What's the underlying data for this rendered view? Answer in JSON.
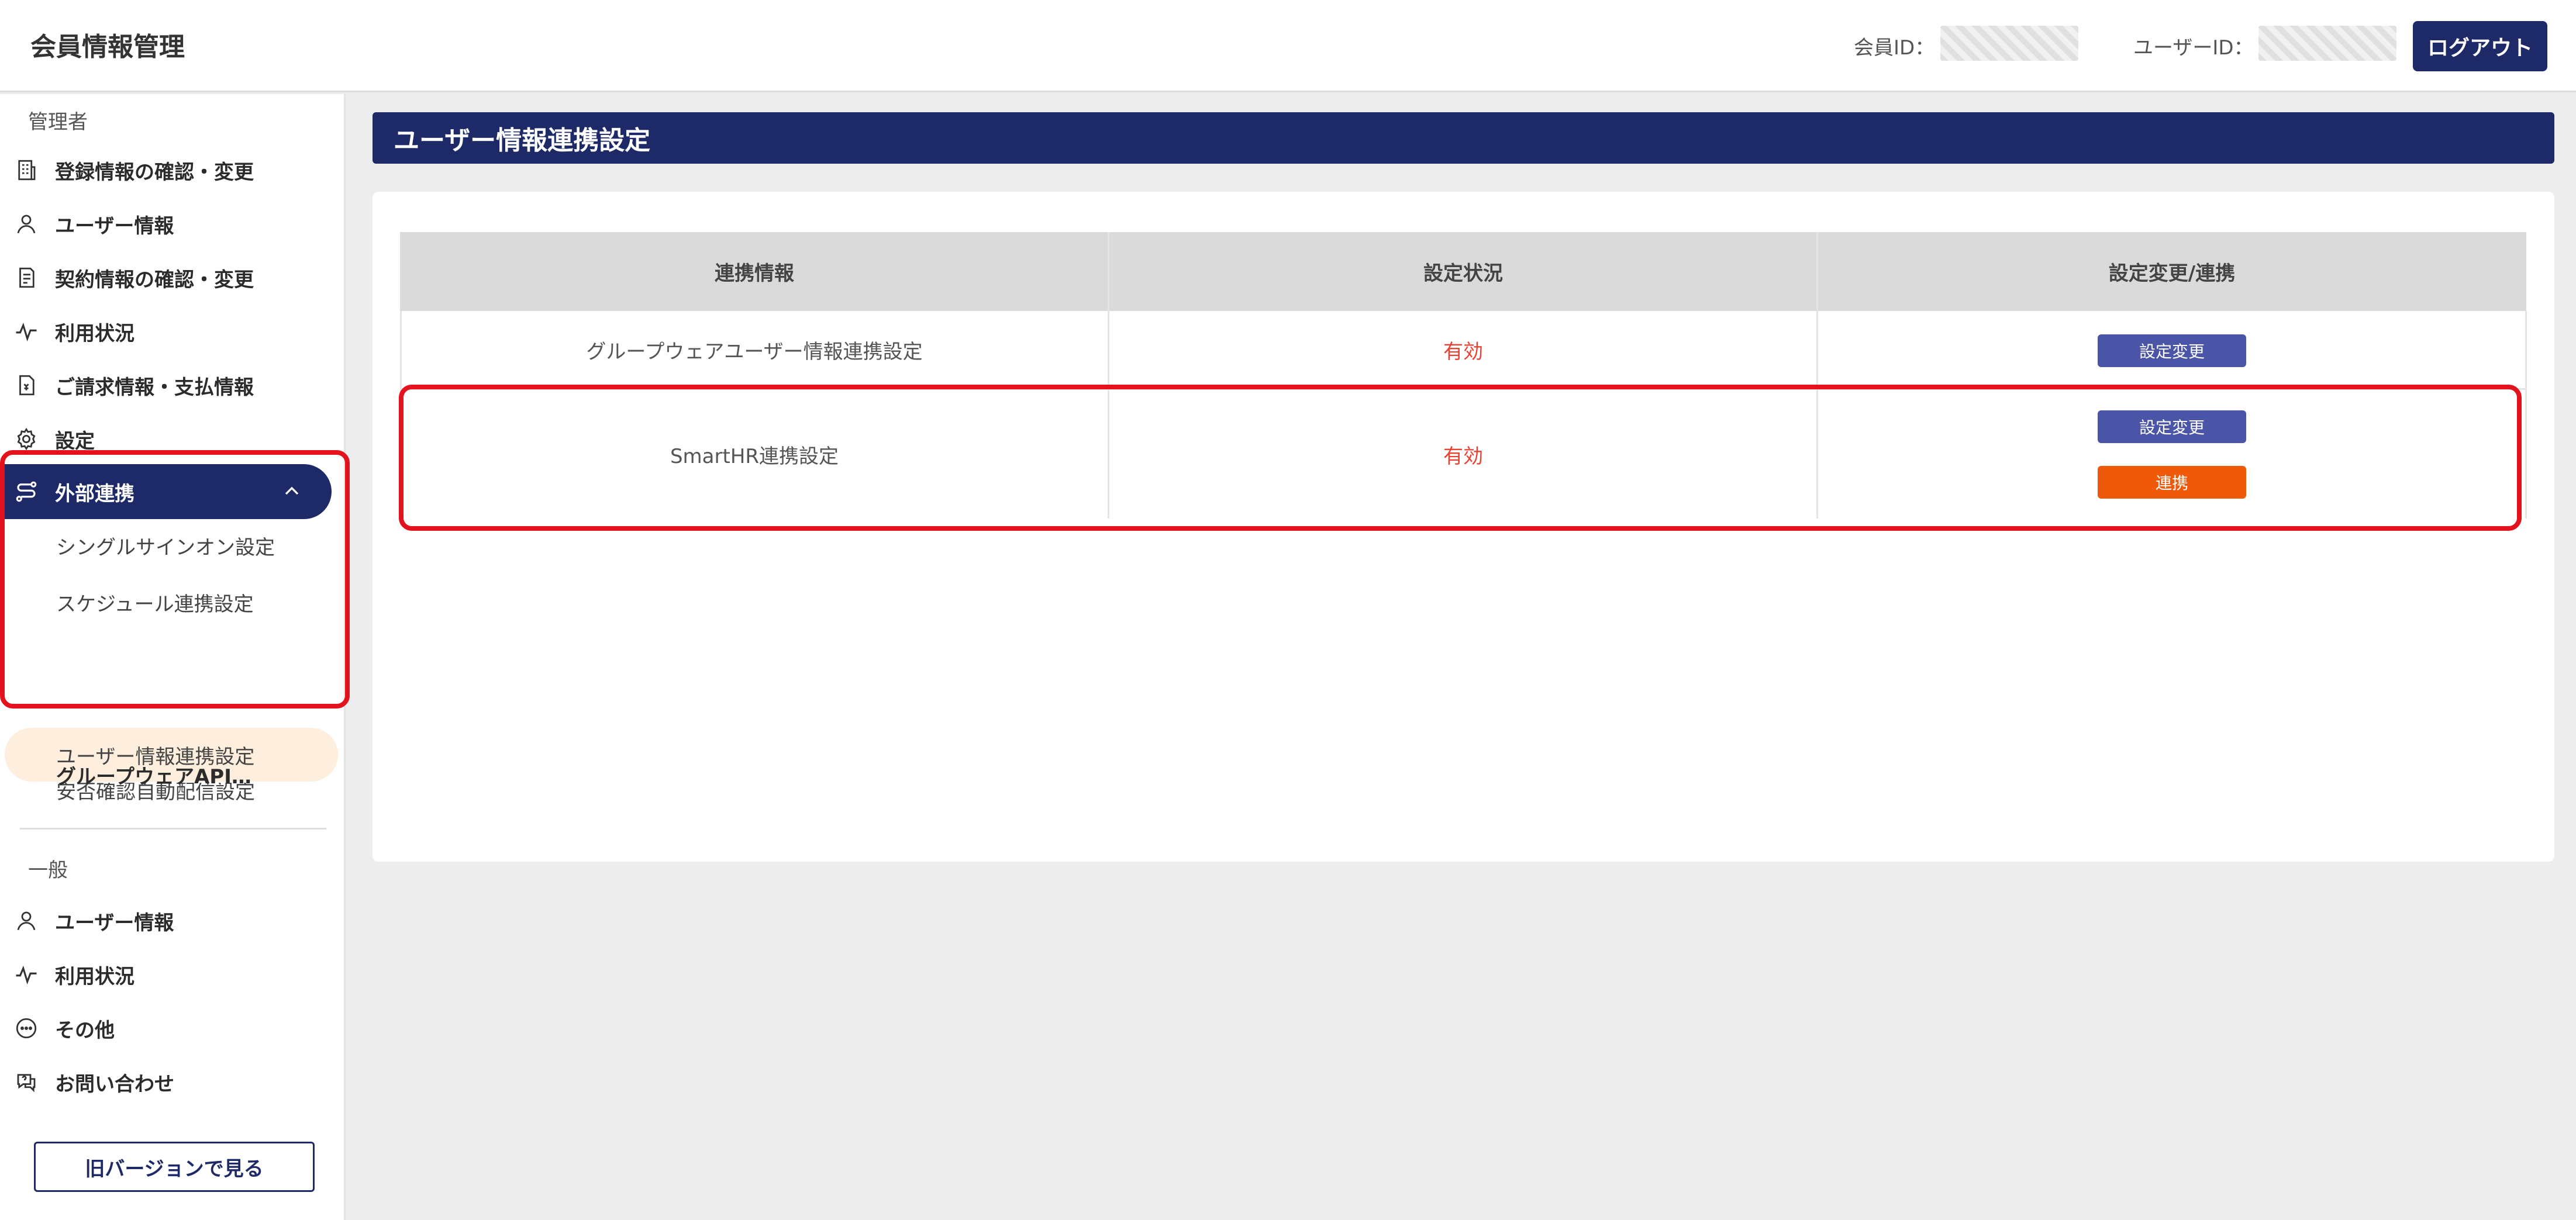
{
  "header": {
    "title": "会員情報管理",
    "member_id_label": "会員ID：",
    "user_id_label": "ユーザーID：",
    "logout_label": "ログアウト"
  },
  "sidebar": {
    "admin_section_label": "管理者",
    "admin_items": [
      {
        "label": "登録情報の確認・変更",
        "icon": "building-icon"
      },
      {
        "label": "ユーザー情報",
        "icon": "user-icon"
      },
      {
        "label": "契約情報の確認・変更",
        "icon": "document-icon"
      },
      {
        "label": "利用状況",
        "icon": "activity-icon"
      },
      {
        "label": "ご請求情報・支払情報",
        "icon": "invoice-icon"
      },
      {
        "label": "設定",
        "icon": "gear-icon"
      }
    ],
    "active_group": {
      "label": "外部連携",
      "icon": "integration-icon",
      "expanded": true
    },
    "sub_items": [
      "シングルサインオン設定",
      "スケジュール連携設定",
      "ユーザー情報連携設定",
      "安否確認自動配信設定",
      "グループウェアAPI…"
    ],
    "active_sub_index": 2,
    "general_section_label": "一般",
    "general_items": [
      {
        "label": "ユーザー情報",
        "icon": "user-icon"
      },
      {
        "label": "利用状況",
        "icon": "activity-icon"
      },
      {
        "label": "その他",
        "icon": "more-icon"
      },
      {
        "label": "お問い合わせ",
        "icon": "chat-question-icon"
      }
    ],
    "old_version_label": "旧バージョンで見る"
  },
  "main": {
    "page_title": "ユーザー情報連携設定",
    "table": {
      "headers": [
        "連携情報",
        "設定状況",
        "設定変更/連携"
      ],
      "rows": [
        {
          "name": "グループウェアユーザー情報連携設定",
          "status": "有効",
          "buttons": [
            "設定変更"
          ]
        },
        {
          "name": "SmartHR連携設定",
          "status": "有効",
          "buttons": [
            "設定変更",
            "連携"
          ]
        }
      ]
    }
  },
  "colors": {
    "navy": "#1e2a68",
    "button_blue": "#4a55a8",
    "button_orange": "#ee5a0a",
    "status_red": "#e84232",
    "highlight_red": "#e3131d",
    "active_sub_bg": "#fdeedd"
  }
}
